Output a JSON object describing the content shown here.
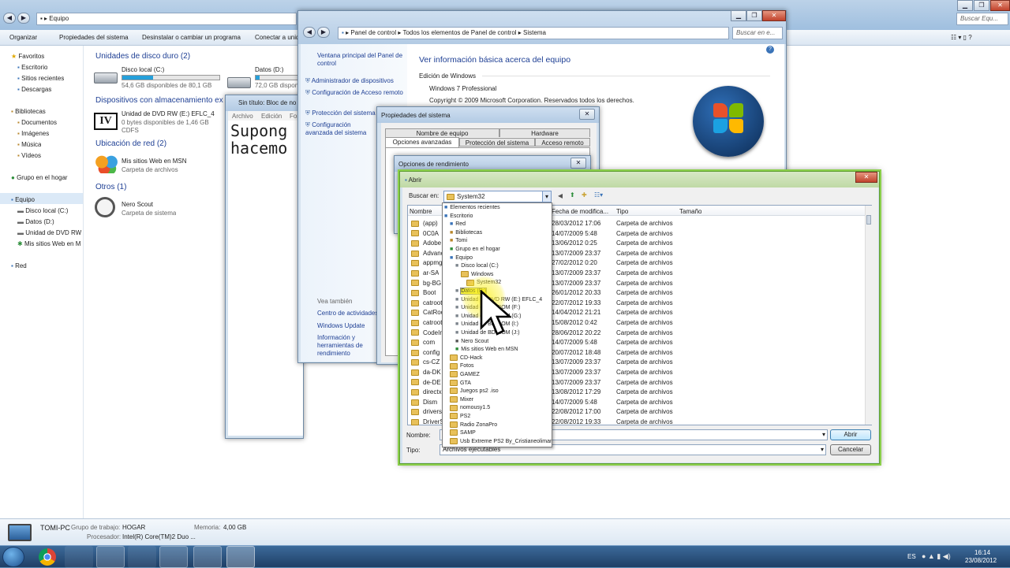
{
  "explorer": {
    "address": "Equipo",
    "search_placeholder": "Buscar Equ...",
    "toolbar": [
      "Organizar",
      "Propiedades del sistema",
      "Desinstalar o cambiar un programa",
      "Conectar a unid"
    ],
    "nav": {
      "favorites_header": "Favoritos",
      "favorites": [
        "Escritorio",
        "Sitios recientes",
        "Descargas"
      ],
      "libraries_header": "Bibliotecas",
      "libraries": [
        "Documentos",
        "Imágenes",
        "Música",
        "Vídeos"
      ],
      "homegroup": "Grupo en el hogar",
      "computer_header": "Equipo",
      "computer": [
        "Disco local (C:)",
        "Datos (D:)",
        "Unidad de DVD RW (",
        "Mis sitios Web en M"
      ],
      "network": "Red"
    },
    "groups": {
      "hdd": "Unidades de disco duro (2)",
      "removable": "Dispositivos con almacenamiento ex",
      "network": "Ubicación de red (2)",
      "other": "Otros (1)"
    },
    "drive_c": {
      "name": "Disco local (C:)",
      "free": "54,6 GB disponibles de 80,1 GB",
      "fill": 0.32
    },
    "drive_d": {
      "name": "Datos (D:)",
      "free": "72,0 GB disponibles de 7",
      "fill": 0.1
    },
    "dvd": {
      "name": "Unidad de DVD RW (E:) EFLC_4",
      "free": "0 bytes disponibles de 1,46 GB",
      "fs": "CDFS",
      "badge": "IV"
    },
    "msn": {
      "name": "Mis sitios Web en MSN",
      "type": "Carpeta de archivos"
    },
    "nero": {
      "name": "Nero Scout",
      "type": "Carpeta de sistema"
    },
    "details": {
      "pc": "TOMI-PC",
      "wg_label": "Grupo de trabajo:",
      "wg": "HOGAR",
      "mem_label": "Memoria:",
      "mem": "4,00 GB",
      "cpu_label": "Procesador:",
      "cpu": "Intel(R) Core(TM)2 Duo ..."
    }
  },
  "notepad": {
    "title": "Sin título: Bloc de no",
    "menu": [
      "Archivo",
      "Edición",
      "Forma"
    ],
    "line1": "Supong",
    "line2": "hacemo"
  },
  "control": {
    "address": [
      "Panel de control",
      "Todos los elementos de Panel de control",
      "Sistema"
    ],
    "search_placeholder": "Buscar en e...",
    "side": [
      "Ventana principal del Panel de control",
      "Administrador de dispositivos",
      "Configuración de Acceso remoto",
      "Protección del sistema",
      "Configuración avanzada del sistema"
    ],
    "see_also": "Vea también",
    "side2": [
      "Centro de actividades",
      "Windows Update",
      "Información y herramientas de rendimiento"
    ],
    "heading": "Ver información básica acerca del equipo",
    "edition_label": "Edición de Windows",
    "edition": "Windows 7 Professional",
    "copyright": "Copyright © 2009 Microsoft Corporation. Reservados todos los derechos."
  },
  "props": {
    "title": "Propiedades del sistema",
    "tabs_top": [
      "Nombre de equipo",
      "Hardware"
    ],
    "tabs_bottom": [
      "Opciones avanzadas",
      "Protección del sistema",
      "Acceso remoto"
    ]
  },
  "perf": {
    "title": "Opciones de rendimiento"
  },
  "open": {
    "title": "Abrir",
    "look_in_label": "Buscar en:",
    "look_in": "System32",
    "columns": [
      "Nombre",
      "Fecha de modifica...",
      "Tipo",
      "Tamaño"
    ],
    "files": [
      {
        "name": "(app)",
        "date": "28/03/2012 17:06",
        "type": "Carpeta de archivos"
      },
      {
        "name": "0C0A",
        "date": "14/07/2009 5:48",
        "type": "Carpeta de archivos"
      },
      {
        "name": "Adobe",
        "date": "13/06/2012 0:25",
        "type": "Carpeta de archivos"
      },
      {
        "name": "Advanc",
        "date": "13/07/2009 23:37",
        "type": "Carpeta de archivos"
      },
      {
        "name": "appmgr",
        "date": "27/02/2012 0:20",
        "type": "Carpeta de archivos"
      },
      {
        "name": "ar-SA",
        "date": "13/07/2009 23:37",
        "type": "Carpeta de archivos"
      },
      {
        "name": "bg-BG",
        "date": "13/07/2009 23:37",
        "type": "Carpeta de archivos"
      },
      {
        "name": "Boot",
        "date": "26/01/2012 20:33",
        "type": "Carpeta de archivos"
      },
      {
        "name": "catroot",
        "date": "22/07/2012 19:33",
        "type": "Carpeta de archivos"
      },
      {
        "name": "CatRoot",
        "date": "14/04/2012 21:21",
        "type": "Carpeta de archivos"
      },
      {
        "name": "catroot2",
        "date": "15/08/2012 0:42",
        "type": "Carpeta de archivos"
      },
      {
        "name": "CodeInt",
        "date": "28/06/2012 20:22",
        "type": "Carpeta de archivos"
      },
      {
        "name": "com",
        "date": "14/07/2009 5:48",
        "type": "Carpeta de archivos"
      },
      {
        "name": "config",
        "date": "20/07/2012 18:48",
        "type": "Carpeta de archivos"
      },
      {
        "name": "cs-CZ",
        "date": "13/07/2009 23:37",
        "type": "Carpeta de archivos"
      },
      {
        "name": "da-DK",
        "date": "13/07/2009 23:37",
        "type": "Carpeta de archivos"
      },
      {
        "name": "de-DE",
        "date": "13/07/2009 23:37",
        "type": "Carpeta de archivos"
      },
      {
        "name": "directx",
        "date": "13/08/2012 17:29",
        "type": "Carpeta de archivos"
      },
      {
        "name": "Dism",
        "date": "14/07/2009 5:48",
        "type": "Carpeta de archivos"
      },
      {
        "name": "drivers",
        "date": "22/08/2012 17:00",
        "type": "Carpeta de archivos"
      },
      {
        "name": "DriverSt",
        "date": "22/08/2012 19:33",
        "type": "Carpeta de archivos"
      }
    ],
    "dropdown": [
      {
        "label": "Elementos recientes",
        "indent": 0,
        "icon": "recent"
      },
      {
        "label": "Escritorio",
        "indent": 0,
        "icon": "desktop"
      },
      {
        "label": "Red",
        "indent": 1,
        "icon": "network"
      },
      {
        "label": "Bibliotecas",
        "indent": 1,
        "icon": "library"
      },
      {
        "label": "Tomi",
        "indent": 1,
        "icon": "user"
      },
      {
        "label": "Grupo en el hogar",
        "indent": 1,
        "icon": "homegroup"
      },
      {
        "label": "Equipo",
        "indent": 1,
        "icon": "computer"
      },
      {
        "label": "Disco local (C:)",
        "indent": 2,
        "icon": "drive"
      },
      {
        "label": "Windows",
        "indent": 3,
        "icon": "folder"
      },
      {
        "label": "System32",
        "indent": 4,
        "icon": "folder"
      },
      {
        "label": "Datos (D:)",
        "indent": 2,
        "icon": "drive",
        "hl": true
      },
      {
        "label": "Unidad de DVD RW (E:) EFLC_4",
        "indent": 2,
        "icon": "dvd"
      },
      {
        "label": "Unidad de BD-ROM (F:)",
        "indent": 2,
        "icon": "dvd"
      },
      {
        "label": "Unidad de BD-ROM (G:)",
        "indent": 2,
        "icon": "dvd"
      },
      {
        "label": "Unidad de BD-ROM (I:)",
        "indent": 2,
        "icon": "dvd"
      },
      {
        "label": "Unidad de BD-ROM (J:)",
        "indent": 2,
        "icon": "dvd"
      },
      {
        "label": "Nero Scout",
        "indent": 2,
        "icon": "nero"
      },
      {
        "label": "Mis sitios Web en MSN",
        "indent": 2,
        "icon": "msn"
      },
      {
        "label": "CD-Hack",
        "indent": 1,
        "icon": "folder"
      },
      {
        "label": "Fotos",
        "indent": 1,
        "icon": "folder"
      },
      {
        "label": "GAMEZ",
        "indent": 1,
        "icon": "folder"
      },
      {
        "label": "GTA",
        "indent": 1,
        "icon": "folder"
      },
      {
        "label": "Juegos ps2 .iso",
        "indent": 1,
        "icon": "folder"
      },
      {
        "label": "Mixer",
        "indent": 1,
        "icon": "folder"
      },
      {
        "label": "nomousy1.5",
        "indent": 1,
        "icon": "folder"
      },
      {
        "label": "PS2",
        "indent": 1,
        "icon": "folder"
      },
      {
        "label": "Radio ZonaPro",
        "indent": 1,
        "icon": "folder"
      },
      {
        "label": "SAMP",
        "indent": 1,
        "icon": "folder"
      },
      {
        "label": "Usb Extreme PS2 By_Cristianeolimany",
        "indent": 1,
        "icon": "folder"
      }
    ],
    "name_label": "Nombre:",
    "name_value": "",
    "type_label": "Tipo:",
    "type_value": "Archivos ejecutables",
    "open_btn": "Abrir",
    "cancel_btn": "Cancelar"
  },
  "taskbar": {
    "lang": "ES",
    "time": "16:14",
    "date": "23/08/2012"
  },
  "colors": {
    "highlight": "#f5f03a",
    "accent": "#1e3f94",
    "disk_bar": "#26a0da"
  }
}
